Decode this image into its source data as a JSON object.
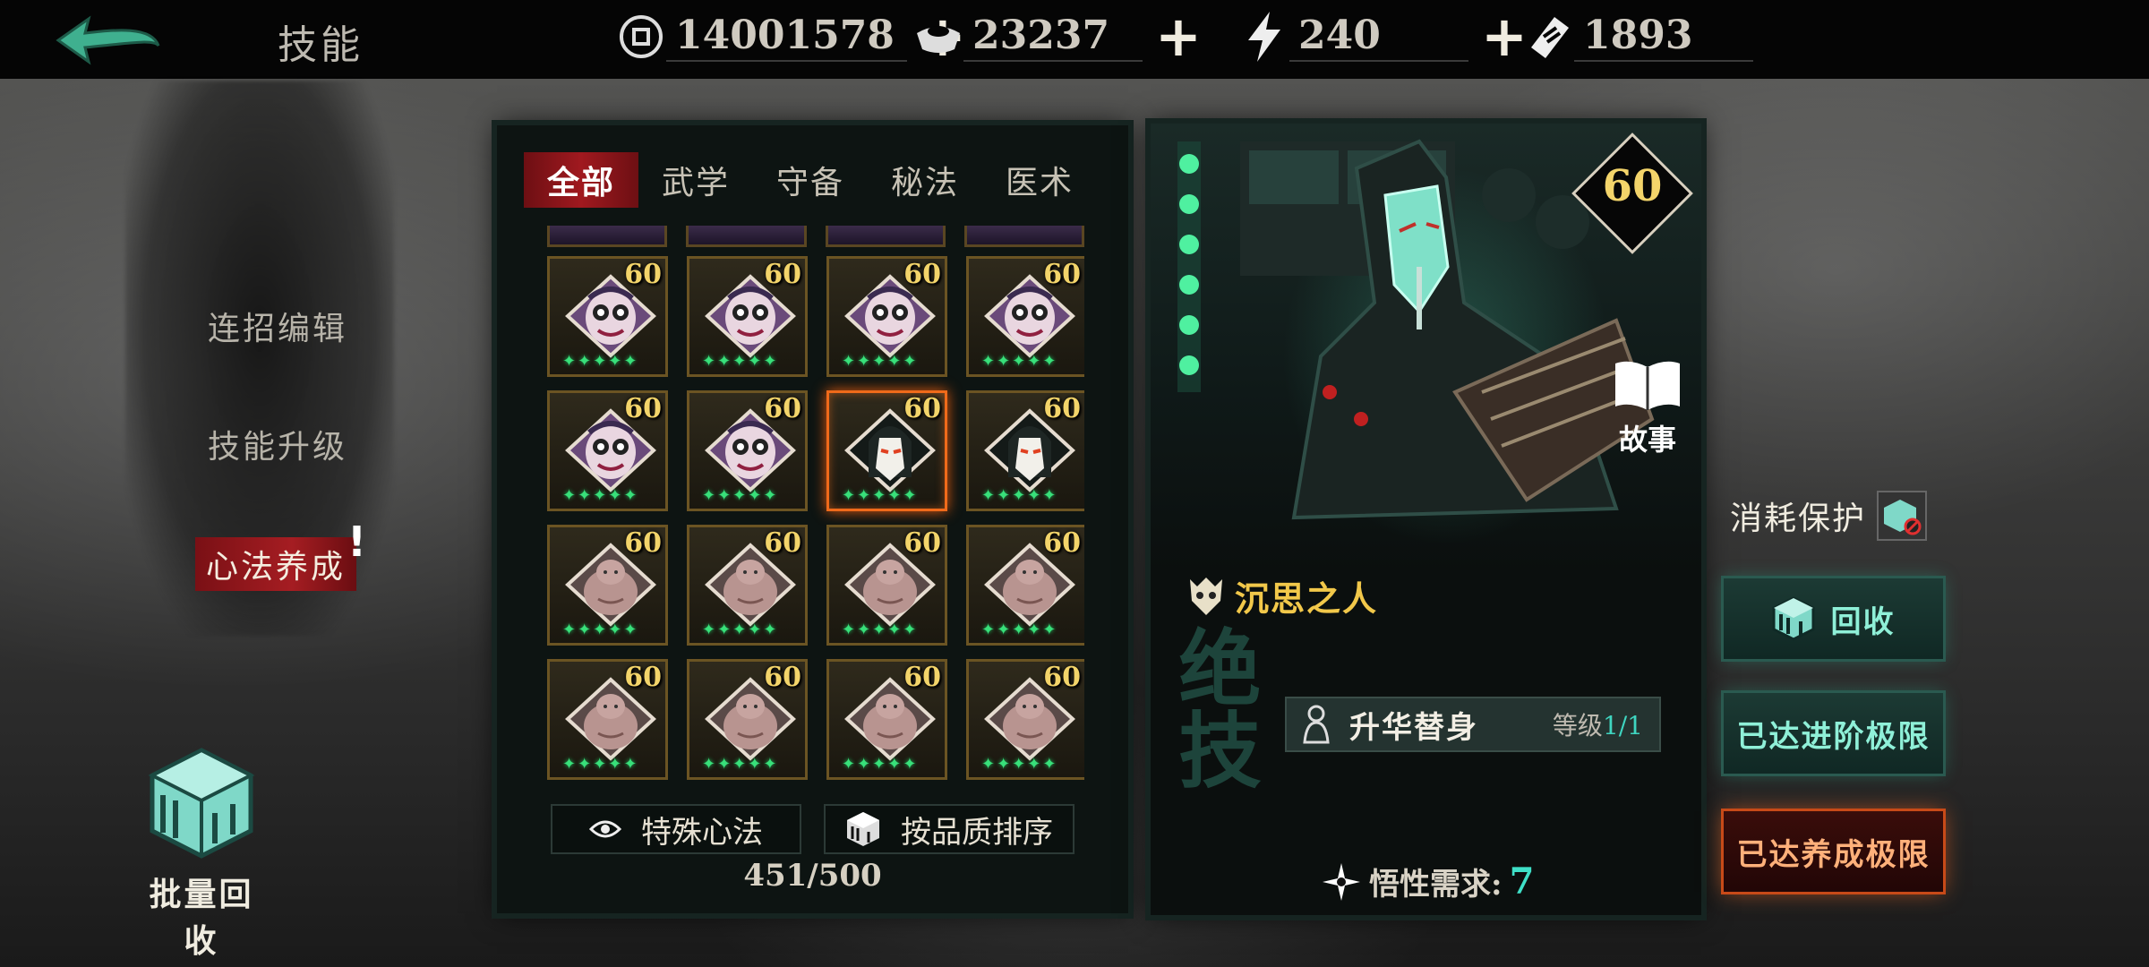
{
  "header": {
    "title": "技能",
    "resources": [
      {
        "icon": "coin-icon",
        "value": "14001578"
      },
      {
        "icon": "ingot-icon",
        "value": "23237"
      },
      {
        "icon": "lightning-icon",
        "value": "240"
      },
      {
        "icon": "ticket-icon",
        "value": "1893"
      }
    ],
    "plus": "+"
  },
  "sidebar": {
    "items": [
      {
        "label": "连招编辑"
      },
      {
        "label": "技能升级"
      },
      {
        "label": "心法养成",
        "active": true,
        "alert": "!"
      }
    ],
    "batch_label": "批量回收"
  },
  "inventory": {
    "tabs": [
      {
        "label": "全部",
        "active": true
      },
      {
        "label": "武学"
      },
      {
        "label": "守备"
      },
      {
        "label": "秘法"
      },
      {
        "label": "医术"
      }
    ],
    "cells": [
      {
        "type": "clown",
        "level": "60"
      },
      {
        "type": "clown",
        "level": "60"
      },
      {
        "type": "clown",
        "level": "60"
      },
      {
        "type": "clown",
        "level": "60"
      },
      {
        "type": "clown",
        "level": "60"
      },
      {
        "type": "clown",
        "level": "60"
      },
      {
        "type": "masked",
        "level": "60",
        "selected": true
      },
      {
        "type": "masked",
        "level": "60"
      },
      {
        "type": "blob",
        "level": "60"
      },
      {
        "type": "blob",
        "level": "60"
      },
      {
        "type": "blob",
        "level": "60"
      },
      {
        "type": "blob",
        "level": "60"
      },
      {
        "type": "blob",
        "level": "60"
      },
      {
        "type": "blob",
        "level": "60"
      },
      {
        "type": "blob",
        "level": "60"
      },
      {
        "type": "blob",
        "level": "60"
      }
    ],
    "special_label": "特殊心法",
    "sort_label": "按品质排序",
    "count": "451/500"
  },
  "detail": {
    "level": "60",
    "story_label": "故事",
    "name": "沉思之人",
    "rank_text": "绝技",
    "skill_name": "升华替身",
    "skill_level_prefix": "等级",
    "skill_level": "1/1",
    "requirement_label": "悟性需求:",
    "requirement_value": "7"
  },
  "actions": {
    "protect_label": "消耗保护",
    "recycle_label": "回收",
    "advance_label": "已达进阶极限",
    "cultivate_label": "已达养成极限"
  },
  "colors": {
    "accent_red": "#a0191f",
    "level_gold": "#f3d46a",
    "teal": "#3fe0c8",
    "selected_orange": "#f06a1a"
  }
}
